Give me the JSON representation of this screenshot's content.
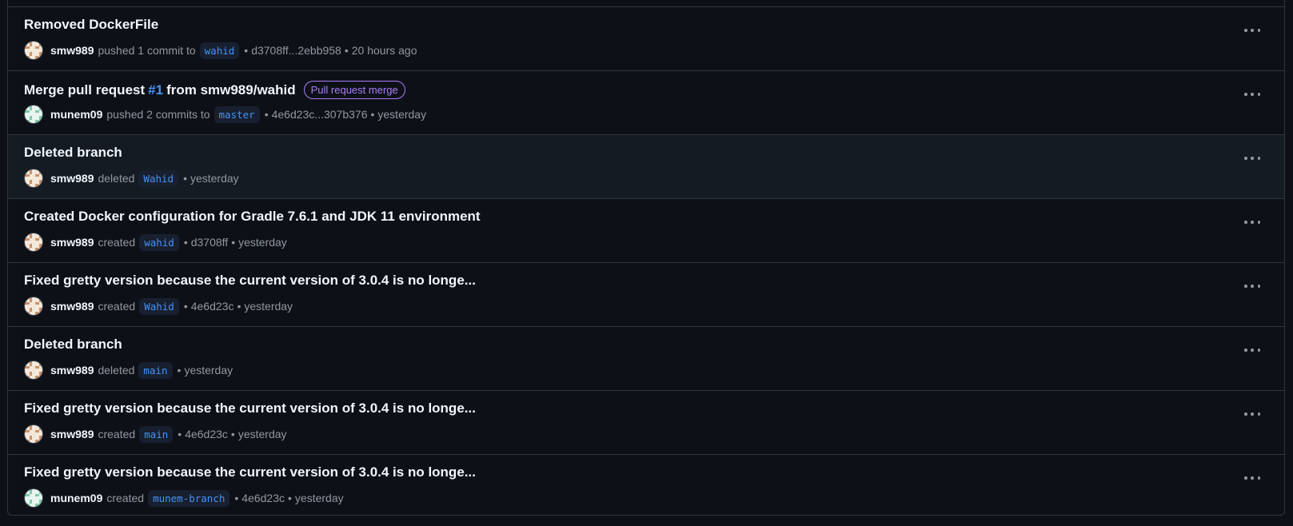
{
  "activities": [
    {
      "title": "Removed DockerFile",
      "user": "smw989",
      "avatar": "smw",
      "verb": "pushed 1 commit to",
      "branch": "wahid",
      "detail": "d3708ff...2ebb958",
      "time": "20 hours ago"
    },
    {
      "title": "Merge pull request",
      "pr_number": "#1",
      "title_suffix": "from smw989/wahid",
      "badge": "Pull request merge",
      "user": "munem09",
      "avatar": "munem",
      "verb": "pushed 2 commits to",
      "branch": "master",
      "detail": "4e6d23c...307b376",
      "time": "yesterday"
    },
    {
      "title": "Deleted branch",
      "user": "smw989",
      "avatar": "smw",
      "verb": "deleted",
      "branch": "Wahid",
      "time": "yesterday",
      "highlight": true
    },
    {
      "title": "Created Docker configuration for Gradle 7.6.1 and JDK 11 environment",
      "user": "smw989",
      "avatar": "smw",
      "verb": "created",
      "branch": "wahid",
      "detail": "d3708ff",
      "time": "yesterday"
    },
    {
      "title": "Fixed gretty version because the current version of 3.0.4 is no longe...",
      "user": "smw989",
      "avatar": "smw",
      "verb": "created",
      "branch": "Wahid",
      "detail": "4e6d23c",
      "time": "yesterday"
    },
    {
      "title": "Deleted branch",
      "user": "smw989",
      "avatar": "smw",
      "verb": "deleted",
      "branch": "main",
      "time": "yesterday"
    },
    {
      "title": "Fixed gretty version because the current version of 3.0.4 is no longe...",
      "user": "smw989",
      "avatar": "smw",
      "verb": "created",
      "branch": "main",
      "detail": "4e6d23c",
      "time": "yesterday"
    },
    {
      "title": "Fixed gretty version because the current version of 3.0.4 is no longe...",
      "user": "munem09",
      "avatar": "munem",
      "verb": "created",
      "branch": "munem-branch",
      "detail": "4e6d23c",
      "time": "yesterday"
    }
  ],
  "dot_separator": "•",
  "menu_icon": "kebab-horizontal-icon",
  "colors": {
    "background": "#0d1117",
    "border": "#30363d",
    "link": "#4493f8",
    "merge_badge": "#ab7df8",
    "muted_text": "#9198a1"
  }
}
